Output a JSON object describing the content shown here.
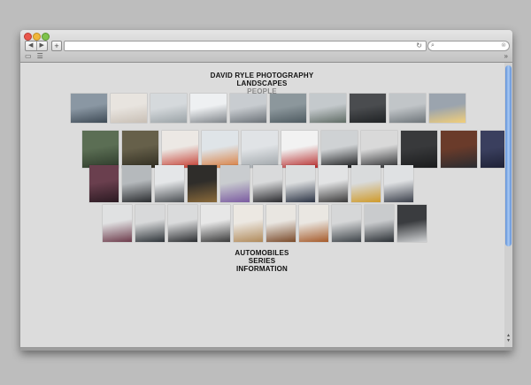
{
  "browser": {
    "nav_back": "◀",
    "nav_forward": "▶",
    "add_tab": "+",
    "url": "",
    "reload_icon": "↻",
    "search_icon": "⌕",
    "search_clear": "⊗",
    "bookmarks": [
      "▭",
      "☰"
    ],
    "more": "»"
  },
  "site": {
    "title": "DAVID RYLE PHOTOGRAPHY",
    "nav_top": [
      "LANDSCAPES",
      "PEOPLE"
    ],
    "active": "PEOPLE",
    "nav_bottom": [
      "AUTOMOBILES",
      "SERIES",
      "INFORMATION"
    ]
  },
  "gallery": {
    "rows": [
      {
        "type": "thumb",
        "colors": [
          [
            "#8a97a3",
            "#3e4a55"
          ],
          [
            "#e8e4df",
            "#c8bfb5"
          ],
          [
            "#d5d9dc",
            "#9aa2a6"
          ],
          [
            "#eef0f2",
            "#7f8489"
          ],
          [
            "#c8ccd0",
            "#6a7076"
          ],
          [
            "#8c979c",
            "#4e5a60"
          ],
          [
            "#c4c9cc",
            "#5f6b64"
          ],
          [
            "#4a4c4f",
            "#1f2224"
          ],
          [
            "#c1c5c8",
            "#6d7479"
          ],
          [
            "#9ba4ae",
            "#f2cf7a"
          ]
        ]
      },
      {
        "type": "tall",
        "colors": [
          [
            "#5b6e54",
            "#2d3a2a"
          ],
          [
            "#66604a",
            "#2f2c20"
          ],
          [
            "#ece8e4",
            "#c43a2e"
          ],
          [
            "#dfe4e8",
            "#d97a3a"
          ],
          [
            "#e0e3e6",
            "#9ca2a6"
          ],
          [
            "#f2f2f2",
            "#b52a2a"
          ],
          [
            "#cfd2d4",
            "#151618"
          ],
          [
            "#d9d9d9",
            "#2a2b2d"
          ],
          [
            "#38393b",
            "#1b1c1d"
          ],
          [
            "#6a3b2a",
            "#2a2c30"
          ],
          [
            "#3a3f5e",
            "#1c1f33"
          ]
        ]
      },
      {
        "type": "tall",
        "colors": [
          [
            "#6a3f4e",
            "#2b1a22"
          ],
          [
            "#b5b9bc",
            "#2a2c2f"
          ],
          [
            "#e4e6e8",
            "#4a4e52"
          ],
          [
            "#2f2d2a",
            "#8a6a3a"
          ],
          [
            "#c9cccf",
            "#7a5aa0"
          ],
          [
            "#d9dadb",
            "#2a2a2e"
          ],
          [
            "#dcdedf",
            "#2b3344"
          ],
          [
            "#e2e3e4",
            "#3b3a3a"
          ],
          [
            "#d9dbdc",
            "#cf9a2a"
          ],
          [
            "#dfe1e3",
            "#3a3f4a"
          ]
        ]
      },
      {
        "type": "tall",
        "colors": [
          [
            "#e0e1e2",
            "#6c3a4a"
          ],
          [
            "#d8d9da",
            "#2d3338"
          ],
          [
            "#dadbdc",
            "#2b2d30"
          ],
          [
            "#e7e7e7",
            "#3a3a3a"
          ],
          [
            "#ece8e2",
            "#b08a5a"
          ],
          [
            "#e9e6e1",
            "#7a4a2a"
          ],
          [
            "#eae7e2",
            "#a55a2a"
          ],
          [
            "#d6d7d8",
            "#3d4348"
          ],
          [
            "#c9cbcd",
            "#2a2f34"
          ],
          [
            "#3a3c3f",
            "#d0d2d4"
          ]
        ]
      }
    ]
  }
}
